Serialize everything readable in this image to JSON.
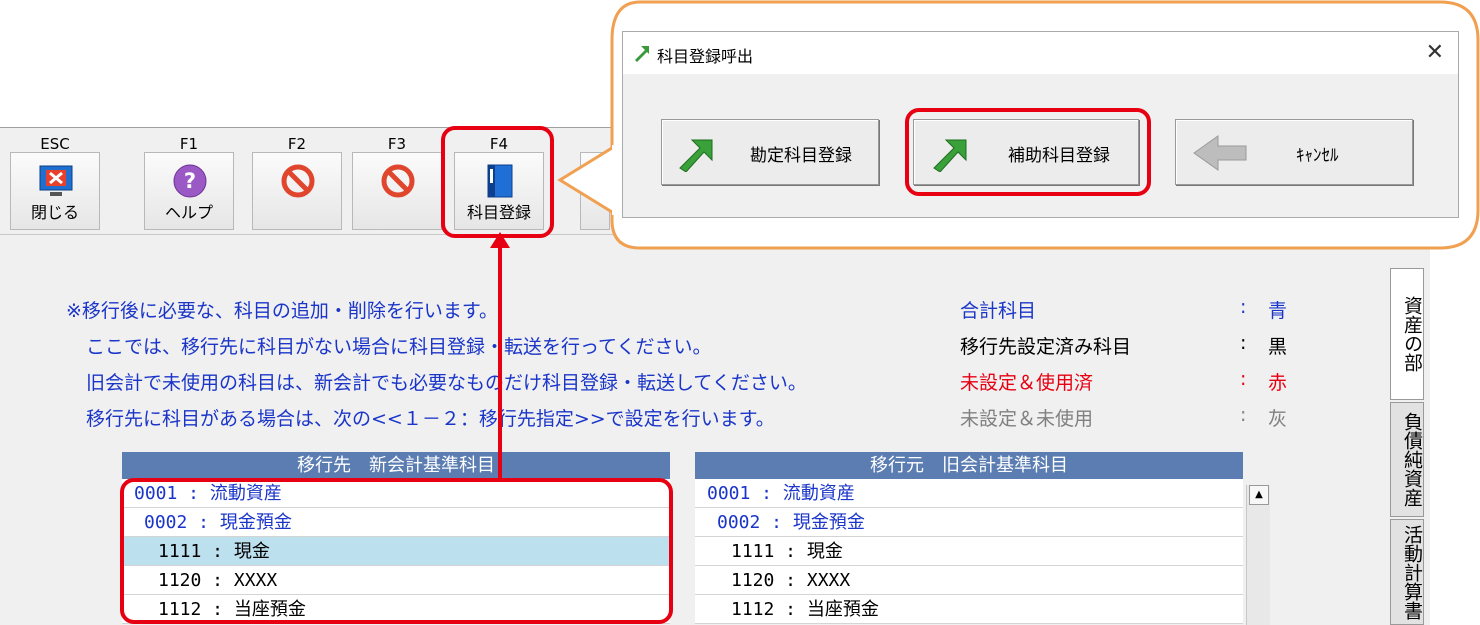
{
  "toolbar": {
    "keys": [
      {
        "key": "ESC",
        "label": "閉じる"
      },
      {
        "key": "F1",
        "label": "ヘルプ"
      },
      {
        "key": "F2",
        "label": ""
      },
      {
        "key": "F3",
        "label": ""
      },
      {
        "key": "F4",
        "label": "科目登録"
      }
    ]
  },
  "messages": [
    "※移行後に必要な、科目の追加・削除を行います。",
    "ここでは、移行先に科目がない場合に科目登録・転送を行ってください。",
    "旧会計で未使用の科目は、新会計でも必要なものだけ科目登録・転送してください。",
    "移行先に科目がある場合は、次の<<１－２：移行先指定>>で設定を行います。"
  ],
  "legend": [
    {
      "name": "合計科目",
      "colon": ":",
      "value": "青",
      "color": "#1a35c8"
    },
    {
      "name": "移行先設定済み科目",
      "colon": ":",
      "value": "黒",
      "color": "#000000"
    },
    {
      "name": "未設定＆使用済",
      "colon": ":",
      "value": "赤",
      "color": "#e60012"
    },
    {
      "name": "未設定＆未使用",
      "colon": ":",
      "value": "灰",
      "color": "#808080"
    }
  ],
  "left_table": {
    "header": "移行先　新会計基準科目",
    "rows": [
      "0001 : 流動資産",
      "0002 : 現金預金",
      "1111 : 現金",
      "1120 : XXXX",
      "1112 : 当座預金"
    ]
  },
  "right_table": {
    "header": "移行元　旧会計基準科目",
    "rows": [
      "0001 : 流動資産",
      "0002 : 現金預金",
      "1111 : 現金",
      "1120 : XXXX",
      "1112 : 当座預金"
    ]
  },
  "side_tabs": [
    "資産の部",
    "負債純資産",
    "活動計算書"
  ],
  "dialog": {
    "title": "科目登録呼出",
    "close": "✕",
    "buttons": [
      "勘定科目登録",
      "補助科目登録",
      "ｷｬﾝｾﾙ"
    ]
  },
  "colors": {
    "accent_red": "#e60012",
    "callout_orange": "#f0a050",
    "blue_text": "#1a35c8",
    "header_blue": "#5b7db1"
  }
}
